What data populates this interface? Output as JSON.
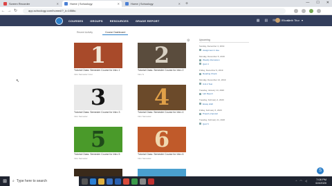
{
  "browser": {
    "tabs": [
      {
        "label": "Screen Recorder",
        "color": "#d44"
      },
      {
        "label": "Home | Schoology",
        "color": "#4a7fd4"
      },
      {
        "label": "Home | Schoology",
        "color": "#4a7fd4"
      }
    ],
    "url": "app.schoology.com/home#/?_k=1t56tu"
  },
  "header": {
    "menu": [
      "COURSES",
      "GROUPS",
      "RESOURCES",
      "GRADE REPORT"
    ],
    "user": "Elizabeth Titor"
  },
  "subtabs": [
    "Recent Activity",
    "Course Dashboard"
  ],
  "courses": [
    {
      "numeral": "1",
      "title": "Tutorial Class: Semester Course for Intro 1",
      "subtitle": "Intro Semester Cour",
      "bg": "#a84a2a",
      "fg": "#f2e9d9"
    },
    {
      "numeral": "2",
      "title": "Tutorial Class: Semester Course for Intro 2",
      "subtitle": "Intro S",
      "bg": "#5a4c3d",
      "fg": "#d8d0c2"
    },
    {
      "numeral": "3",
      "title": "Tutorial Class: Semester Course for Intro 3",
      "subtitle": "Intro Semester",
      "bg": "#e9e9e9",
      "fg": "#151515"
    },
    {
      "numeral": "4",
      "title": "Tutorial Class: Semester Course for Intro 4",
      "subtitle": "Intro Semester",
      "bg": "#6b4a2a",
      "fg": "#e0a048"
    },
    {
      "numeral": "5",
      "title": "Tutorial Class: Semester Course for Intro 5",
      "subtitle": "Intro Semester",
      "bg": "#4a9a2a",
      "fg": "#1f4a1a"
    },
    {
      "numeral": "6",
      "title": "Tutorial Class: Semester Course for Intro 6",
      "subtitle": "Intro Semester",
      "bg": "#c05a2a",
      "fg": "#f0d8b0"
    }
  ],
  "upcoming": {
    "heading": "Upcoming",
    "sections": [
      {
        "date": "Sunday, December 4, 2019",
        "items": [
          "Assignment 1 due"
        ]
      },
      {
        "date": "Monday, December 5, 2019",
        "items": [
          "Weekly discussion",
          "Quiz 3"
        ]
      },
      {
        "date": "Friday, December 9, 2019",
        "items": [
          "Reading Check"
        ]
      },
      {
        "date": "Monday, December 12, 2019",
        "items": [
          "Unit 2 Test"
        ]
      },
      {
        "date": "Tuesday, January 14, 2020",
        "items": [
          "Lab Report"
        ]
      },
      {
        "date": "Tuesday, February 4, 2020",
        "items": [
          "Essay draft"
        ]
      },
      {
        "date": "Friday, February 6, 2020",
        "items": [
          "Project proposal"
        ]
      },
      {
        "date": "Tuesday, February 11, 2020",
        "items": [
          "Quiz 5"
        ]
      }
    ]
  },
  "taskbar": {
    "search_placeholder": "Type here to search",
    "time": "7:08 PM",
    "date": "6/4/2020"
  }
}
